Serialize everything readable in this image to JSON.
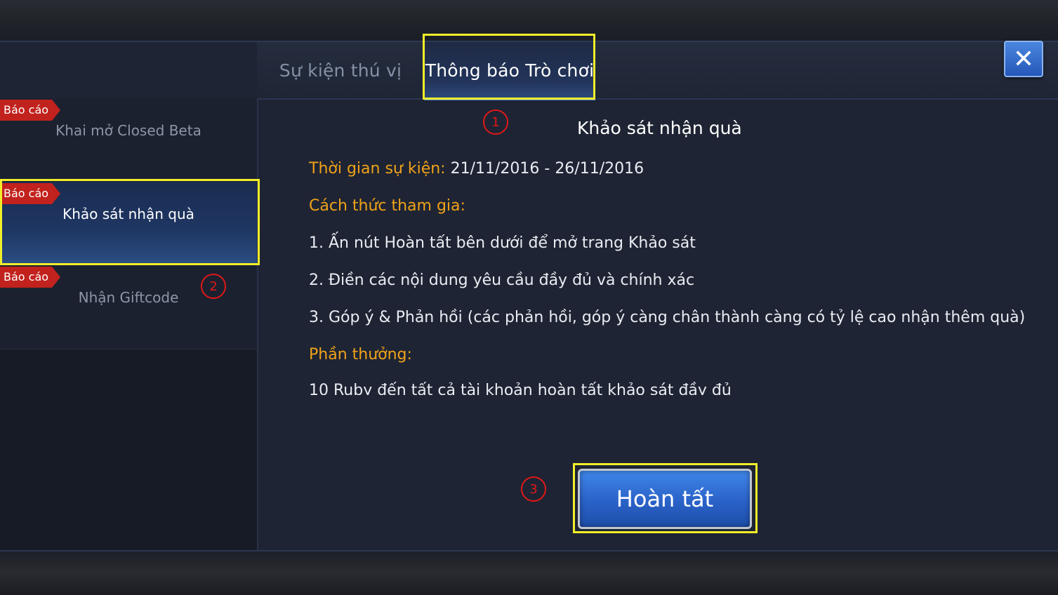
{
  "tabs": [
    {
      "label": "Sự kiện thú vị"
    },
    {
      "label": "Thông báo Trò chơi"
    }
  ],
  "close": {
    "glyph": "✕",
    "icon": "close-icon"
  },
  "sidebar": {
    "items": [
      {
        "badge": "Báo cáo",
        "label": "Khai mở Closed Beta"
      },
      {
        "badge": "Báo cáo",
        "label": "Khảo sát nhận quà"
      },
      {
        "badge": "Báo cáo",
        "label": "Nhận Giftcode"
      }
    ]
  },
  "article": {
    "title": "Khảo sát nhận quà",
    "time_label": "Thời gian sự kiện:",
    "time_value": " 21/11/2016 - 26/11/2016",
    "how_label": "Cách thức tham gia:",
    "steps": [
      "1. Ấn nút Hoàn tất bên dưới để mở trang Khảo sát",
      "2. Điền các nội dung yêu cầu đầy đủ và chính xác",
      "3. Góp ý & Phản hồi (các phản hồi, góp ý càng chân thành càng có tỷ lệ cao nhận thêm quà)"
    ],
    "reward_label": "Phần thưởng:",
    "reward_text": "10 Ruby đến tất cả tài khoản hoàn tất khảo sát đầy đủ"
  },
  "done_button": {
    "label": "Hoàn tất"
  },
  "markers": [
    "1",
    "2",
    "3"
  ],
  "colors": {
    "accent_orange": "#f0a21a",
    "highlight": "#f1ee2a",
    "badge_red": "#c2221d",
    "marker_red": "#e01818"
  }
}
